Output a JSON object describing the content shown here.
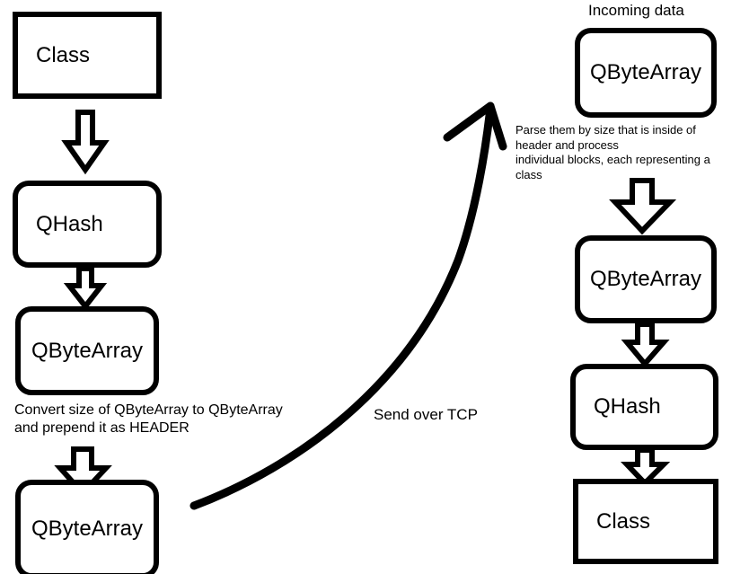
{
  "diagram": {
    "title_right": "Incoming data",
    "send_label": "Send over TCP",
    "left_flow": {
      "nodes": [
        {
          "label": "Class",
          "shape": "rectangle"
        },
        {
          "label": "QHash",
          "shape": "rounded-rectangle"
        },
        {
          "label": "QByteArray",
          "shape": "rounded-rectangle"
        },
        {
          "label": "QByteArray",
          "shape": "rounded-rectangle"
        }
      ],
      "caption": "Convert size of QByteArray to QByteArray\nand prepend it as HEADER"
    },
    "right_flow": {
      "nodes": [
        {
          "label": "QByteArray",
          "shape": "rounded-rectangle"
        },
        {
          "label": "QByteArray",
          "shape": "rounded-rectangle"
        },
        {
          "label": "QHash",
          "shape": "rounded-rectangle"
        },
        {
          "label": "Class",
          "shape": "rectangle"
        }
      ],
      "caption": "Parse them by size that is inside of\nheader and process\nindividual blocks, each representing a\nclass"
    },
    "colors": {
      "stroke": "#000000",
      "fill": "#ffffff",
      "text": "#000000"
    }
  }
}
